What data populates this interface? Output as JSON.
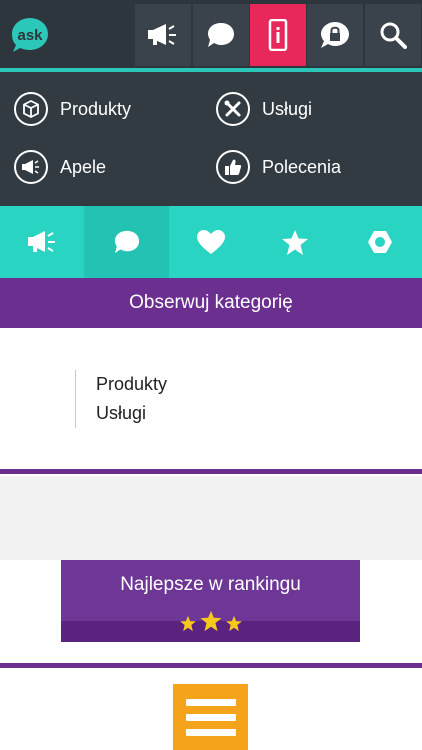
{
  "app": {
    "logo_text": "ask"
  },
  "topnav": {
    "buttons": [
      {
        "icon": "megaphone-icon"
      },
      {
        "icon": "chat-bubble-icon"
      },
      {
        "icon": "mobile-phone-icon",
        "active": true
      },
      {
        "icon": "lock-bubble-icon"
      },
      {
        "icon": "search-icon"
      }
    ]
  },
  "menu": {
    "items": [
      {
        "label": "Produkty",
        "icon": "box-icon"
      },
      {
        "label": "Usługi",
        "icon": "tools-icon"
      },
      {
        "label": "Apele",
        "icon": "megaphone-icon"
      },
      {
        "label": "Polecenia",
        "icon": "thumbs-up-icon"
      }
    ]
  },
  "category_tabs": [
    {
      "icon": "megaphone-icon"
    },
    {
      "icon": "chat-bubble-icon",
      "active": true
    },
    {
      "icon": "heart-icon"
    },
    {
      "icon": "star-icon"
    },
    {
      "icon": "hexagon-nut-icon"
    }
  ],
  "follow_banner": {
    "label": "Obserwuj kategorię"
  },
  "followed": {
    "items": [
      "Produkty",
      "Usługi"
    ]
  },
  "ranking": {
    "title": "Najlepsze w rankingu",
    "stars": 3
  },
  "colors": {
    "topbar": "#2d353d",
    "accent_pink": "#e8275b",
    "teal": "#2ad4c3",
    "purple": "#6b2f8f",
    "star": "#f7c81c",
    "orange": "#f5a31a"
  }
}
